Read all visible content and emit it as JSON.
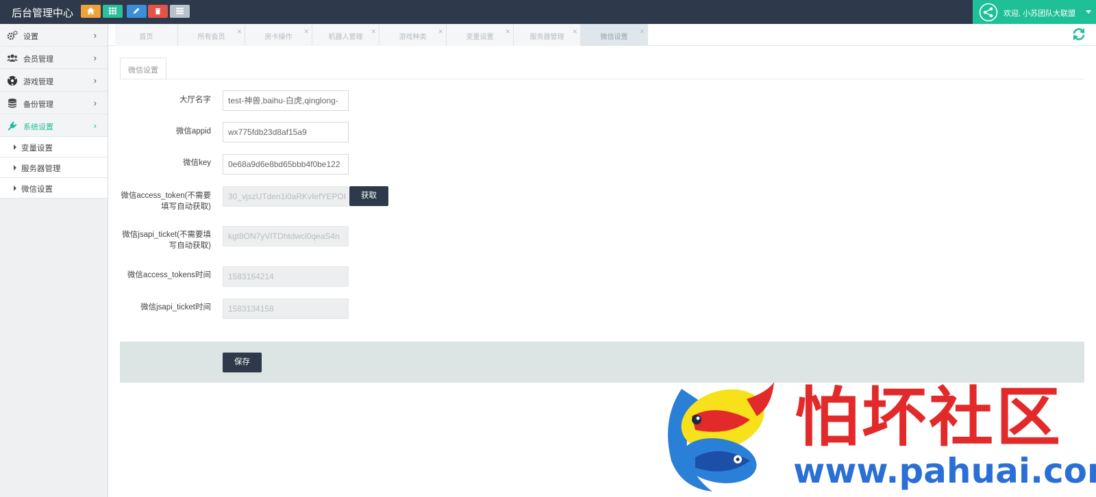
{
  "app": {
    "title": "后台管理中心",
    "quick_icons": [
      "home-icon",
      "grid-icon",
      "pencil-icon",
      "trash-icon",
      "list-icon"
    ],
    "quick_colors": [
      "#f0a23a",
      "#2bbf9c",
      "#3b8ed8",
      "#e2544a",
      "#b8c1cc"
    ]
  },
  "user": {
    "welcome": "欢迎, 小苏团队大联盟"
  },
  "sidebar": {
    "items": [
      {
        "label": "设置",
        "icon": "gears-icon"
      },
      {
        "label": "会员管理",
        "icon": "users-icon"
      },
      {
        "label": "游戏管理",
        "icon": "soccer-ball-icon"
      },
      {
        "label": "备份管理",
        "icon": "database-icon"
      },
      {
        "label": "系统设置",
        "icon": "plug-icon",
        "active": true
      }
    ],
    "sub_items": [
      {
        "label": "变量设置"
      },
      {
        "label": "服务器管理"
      },
      {
        "label": "微信设置"
      }
    ]
  },
  "tabs": [
    {
      "label": "首页",
      "closable": false
    },
    {
      "label": "所有会员",
      "closable": true
    },
    {
      "label": "房卡操作",
      "closable": true
    },
    {
      "label": "机器人管理",
      "closable": true
    },
    {
      "label": "游戏种类",
      "closable": true
    },
    {
      "label": "变量设置",
      "closable": true
    },
    {
      "label": "服务器管理",
      "closable": true
    },
    {
      "label": "微信设置",
      "closable": true,
      "active": true
    }
  ],
  "panel": {
    "tab_label": "微信设置"
  },
  "form": {
    "hall_name": {
      "label": "大厅名字",
      "value": "test-神兽,baihu-白虎,qinglong-"
    },
    "appid": {
      "label": "微信appid",
      "value": "wx775fdb23d8af15a9"
    },
    "key": {
      "label": "微信key",
      "value": "0e68a9d6e8bd65bbb4f0be122"
    },
    "access_token": {
      "label": "微信access_token(不需要填写自动获取)",
      "value": "30_vjszUTden1i0aRKvIefYEPOI"
    },
    "jsapi_ticket": {
      "label": "微信jsapi_ticket(不需要填写自动获取)",
      "value": "kgt8ON7yVITDhtdwci0qeaS4n"
    },
    "access_tokens_time": {
      "label": "微信access_tokens时间",
      "value": "1583164214"
    },
    "jsapi_ticket_time": {
      "label": "微信jsapi_ticket时间",
      "value": "1583134158"
    },
    "fetch_label": "获取",
    "save_label": "保存"
  },
  "watermark": {
    "text": "怕坏社区",
    "url": "www.pahuai.com"
  },
  "colors": {
    "topbar": "#2e3a4b",
    "accent": "#1fbf97",
    "button": "#2e3a4b"
  }
}
